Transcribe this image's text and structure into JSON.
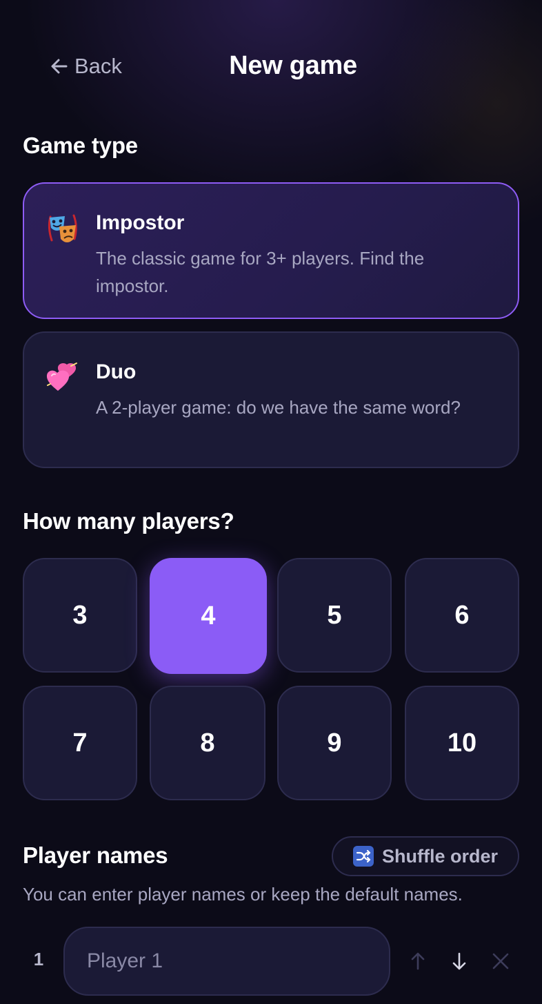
{
  "header": {
    "back_label": "Back",
    "title": "New game"
  },
  "game_type": {
    "section_title": "Game type",
    "options": [
      {
        "name": "Impostor",
        "description": "The classic game for 3+ players. Find the impostor.",
        "icon": "theater-masks-icon",
        "selected": true
      },
      {
        "name": "Duo",
        "description": "A 2-player game: do we have the same word?",
        "icon": "two-hearts-icon",
        "selected": false
      }
    ]
  },
  "player_count": {
    "section_title": "How many players?",
    "options": [
      "3",
      "4",
      "5",
      "6",
      "7",
      "8",
      "9",
      "10"
    ],
    "selected": "4"
  },
  "player_names": {
    "section_title": "Player names",
    "shuffle_label": "Shuffle order",
    "hint": "You can enter player names or keep the default names.",
    "rows": [
      {
        "index": "1",
        "placeholder": "Player 1",
        "value": ""
      }
    ]
  },
  "colors": {
    "accent": "#8b5cf6",
    "background": "#0c0b18",
    "card": "#1b1a36",
    "muted_text": "#a8a7c2"
  }
}
